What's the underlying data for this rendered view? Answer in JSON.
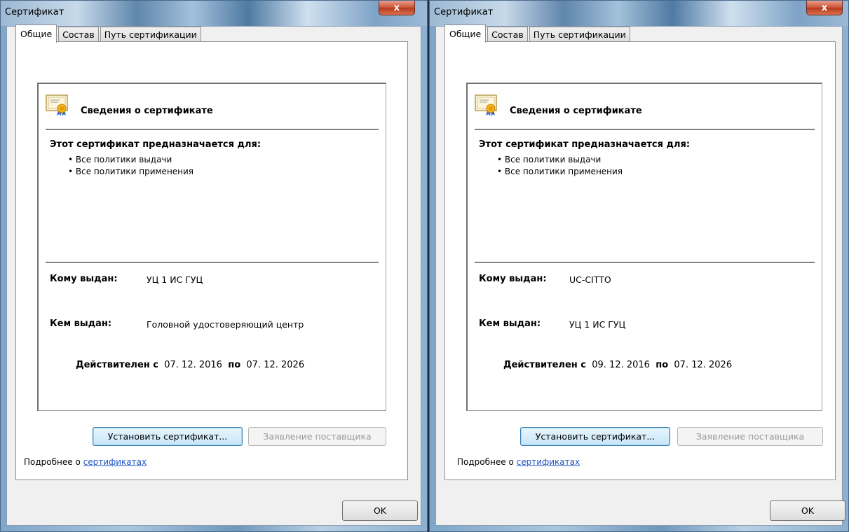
{
  "dialogs": [
    {
      "title": "Сертификат",
      "close_label": "x",
      "tabs": [
        "Общие",
        "Состав",
        "Путь сертификации"
      ],
      "info_title": "Сведения о сертификате",
      "purpose_heading": "Этот сертификат предназначается для:",
      "purposes": [
        "Все политики выдачи",
        "Все политики применения"
      ],
      "issued_to_label": "Кому выдан:",
      "issued_to": "УЦ 1 ИС ГУЦ",
      "issued_by_label": "Кем выдан:",
      "issued_by": "Головной удостоверяющий центр",
      "valid_from_label": "Действителен с",
      "valid_from": "07. 12. 2016",
      "valid_to_label": "по",
      "valid_to": "07. 12. 2026",
      "install_button": "Установить сертификат...",
      "issuer_statement_button": "Заявление поставщика",
      "more_text": "Подробнее о ",
      "more_link": "сертификатах",
      "ok_button": "OK"
    },
    {
      "title": "Сертификат",
      "close_label": "x",
      "tabs": [
        "Общие",
        "Состав",
        "Путь сертификации"
      ],
      "info_title": "Сведения о сертификате",
      "purpose_heading": "Этот сертификат предназначается для:",
      "purposes": [
        "Все политики выдачи",
        "Все политики применения"
      ],
      "issued_to_label": "Кому выдан:",
      "issued_to": "UC-CITTO",
      "issued_by_label": "Кем выдан:",
      "issued_by": "УЦ 1 ИС ГУЦ",
      "valid_from_label": "Действителен с",
      "valid_from": "09. 12. 2016",
      "valid_to_label": "по",
      "valid_to": "07. 12. 2026",
      "install_button": "Установить сертификат...",
      "issuer_statement_button": "Заявление поставщика",
      "more_text": "Подробнее о ",
      "more_link": "сертификатах",
      "ok_button": "OK"
    }
  ]
}
